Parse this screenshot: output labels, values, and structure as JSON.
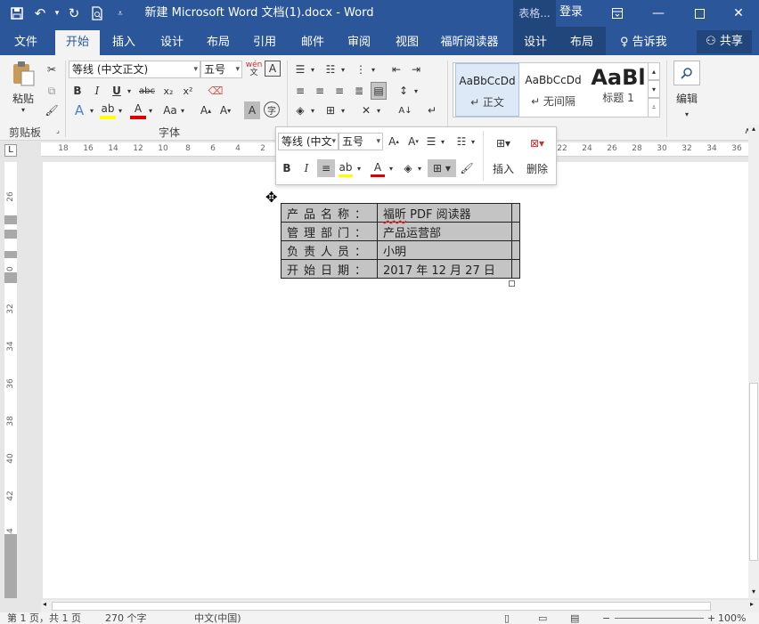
{
  "titlebar": {
    "title": "新建 Microsoft Word 文档(1).docx  -  Word",
    "context_group": "表格...",
    "login": "登录",
    "colors": {
      "bg": "#2b579a",
      "ctx": "#21467c"
    }
  },
  "tabs": [
    "文件",
    "开始",
    "插入",
    "设计",
    "布局",
    "引用",
    "邮件",
    "审阅",
    "视图",
    "福昕阅读器",
    "设计",
    "布局"
  ],
  "tell_me": "告诉我",
  "share": "共享",
  "ribbon": {
    "clipboard": {
      "paste": "粘贴",
      "label": "剪贴板"
    },
    "font": {
      "name": "等线 (中文正文)",
      "size": "五号",
      "label": "字体",
      "wen": "wén\n文"
    },
    "styles": [
      {
        "preview": "AaBbCcDd",
        "name": "↵ 正文"
      },
      {
        "preview": "AaBbCcDd",
        "name": "↵ 无间隔"
      },
      {
        "preview": "AaBl",
        "name": "标题 1"
      }
    ],
    "editing": "编辑"
  },
  "mini_toolbar": {
    "font": "等线 (中文",
    "size": "五号",
    "insert": "插入",
    "delete": "删除"
  },
  "ruler": {
    "h_ticks": [
      "18",
      "16",
      "14",
      "12",
      "10",
      "8",
      "6",
      "4",
      "2",
      "",
      "",
      "",
      "",
      "",
      "",
      "",
      "",
      "",
      "",
      "",
      "22",
      "24",
      "26",
      "28",
      "30",
      "32",
      "34",
      "36"
    ],
    "v_ticks": [
      "26",
      "28",
      "30",
      "32",
      "34",
      "36",
      "38",
      "40",
      "42",
      "44",
      "46"
    ]
  },
  "table": {
    "rows": [
      {
        "label": "产品名称：",
        "value_a": "福昕",
        "value_b": " PDF 阅读器"
      },
      {
        "label": "管理部门：",
        "value_a": "",
        "value_b": "产品运营部"
      },
      {
        "label": "负责人员：",
        "value_a": "",
        "value_b": "小明"
      },
      {
        "label": "开始日期：",
        "value_a": "",
        "value_b": "2017 年 12 月 27 日"
      }
    ]
  },
  "status": {
    "page": "第 1 页，共 1 页",
    "words": "270 个字",
    "lang": "中文(中国)",
    "zoom": "100%"
  }
}
